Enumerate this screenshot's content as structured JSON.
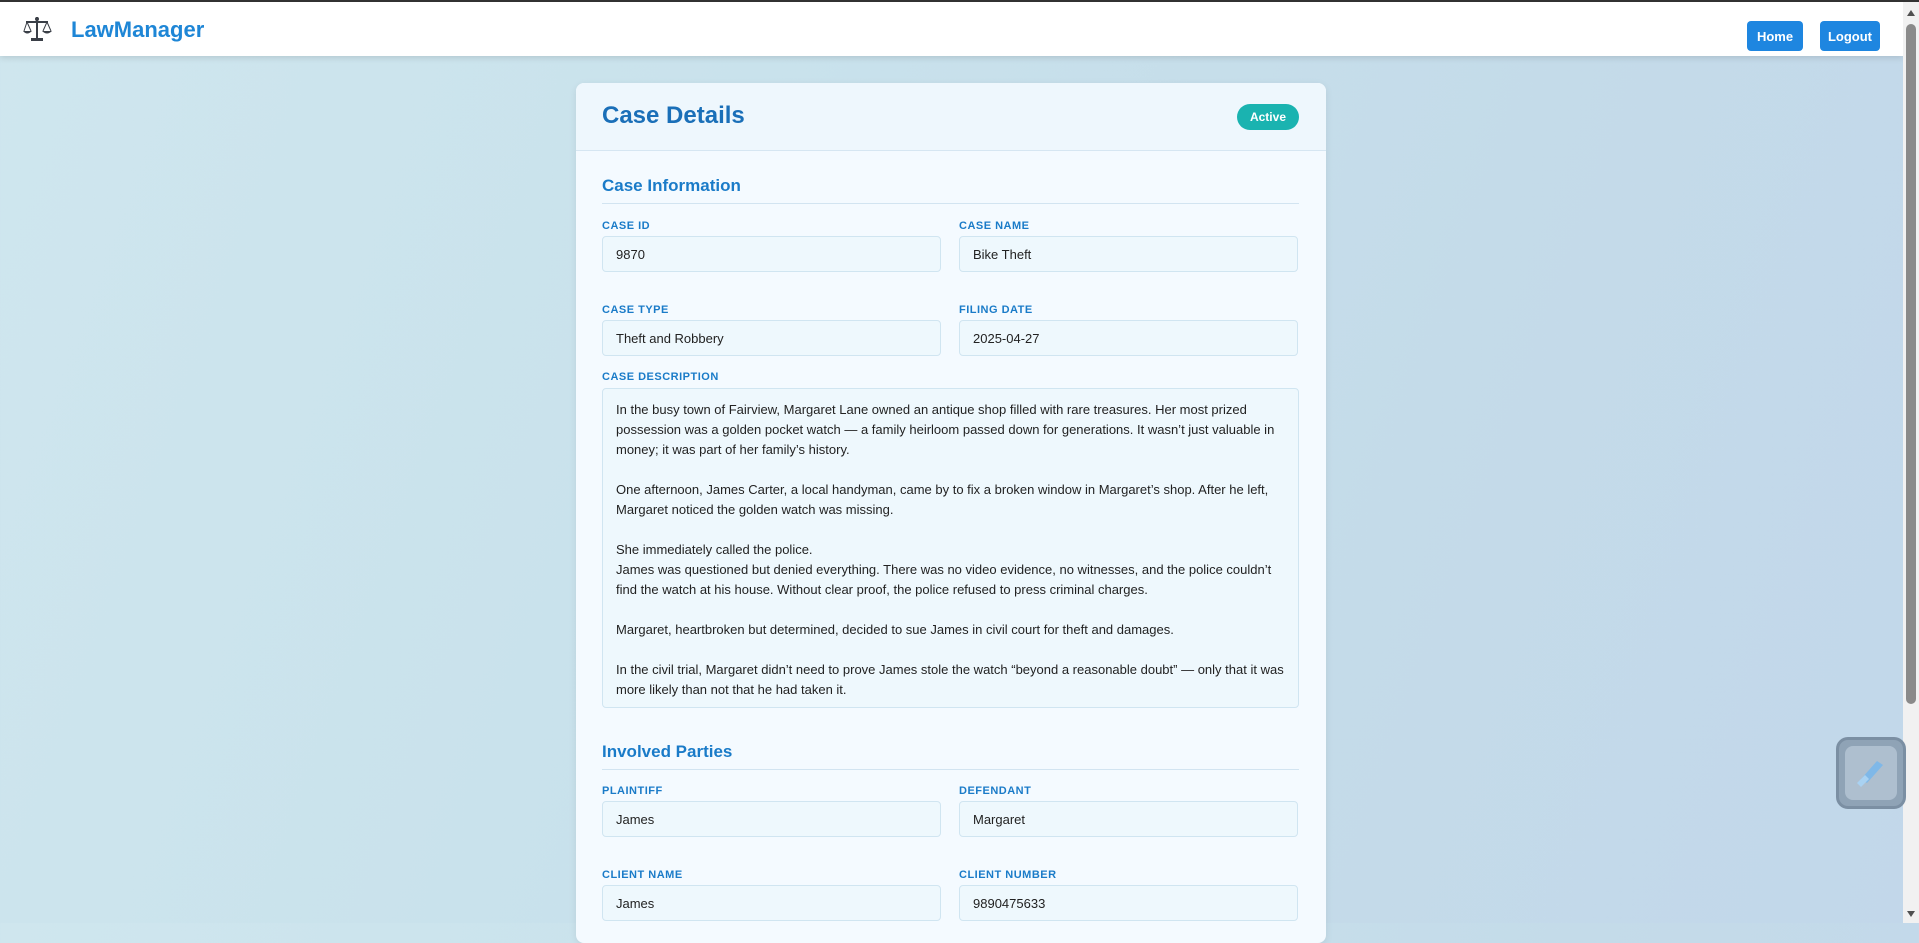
{
  "app": {
    "brand": "LawManager"
  },
  "nav": {
    "home_label": "Home",
    "logout_label": "Logout"
  },
  "case": {
    "title": "Case Details",
    "status": "Active",
    "info_section": "Case Information",
    "fields": {
      "case_id_label": "CASE ID",
      "case_id": "9870",
      "case_name_label": "CASE NAME",
      "case_name": "Bike Theft",
      "case_type_label": "CASE TYPE",
      "case_type": "Theft and Robbery",
      "filing_date_label": "FILING DATE",
      "filing_date": "2025-04-27",
      "description_label": "CASE DESCRIPTION"
    },
    "description": [
      "In the busy town of Fairview, Margaret Lane owned an antique shop filled with rare treasures. Her most prized possession was a golden pocket watch — a family heirloom passed down for generations. It wasn’t just valuable in money; it was part of her family’s history.",
      "One afternoon, James Carter, a local handyman, came by to fix a broken window in Margaret’s shop. After he left, Margaret noticed the golden watch was missing.",
      "She immediately called the police.",
      "James was questioned but denied everything. There was no video evidence, no witnesses, and the police couldn’t find the watch at his house. Without clear proof, the police refused to press criminal charges.",
      "Margaret, heartbroken but determined, decided to sue James in civil court for theft and damages.",
      "In the civil trial, Margaret didn’t need to prove James stole the watch “beyond a reasonable doubt” — only that it was more likely than not that he had taken it."
    ],
    "parties_section": "Involved Parties",
    "parties": {
      "plaintiff_label": "PLAINTIFF",
      "plaintiff": "James",
      "defendant_label": "DEFENDANT",
      "defendant": "Margaret",
      "client_name_label": "CLIENT NAME",
      "client_name": "James",
      "client_number_label": "CLIENT NUMBER",
      "client_number": "9890475633"
    }
  },
  "icons": {
    "logo": "scales-of-justice-icon",
    "widget": "slash-logo-icon"
  },
  "colors": {
    "accent": "#1e86e0",
    "status": "#1ab3b0",
    "heading": "#1a7bc8"
  }
}
